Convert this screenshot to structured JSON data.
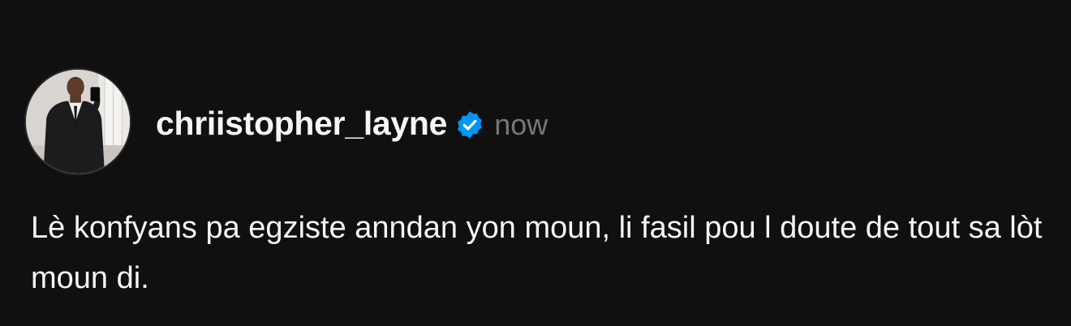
{
  "post": {
    "username": "chriistopher_layne",
    "timestamp": "now",
    "text": "Lè konfyans pa egziste anndan yon moun, li fasil pou l doute de tout sa lòt moun di.",
    "avatar_icon": "profile-photo",
    "verified_icon": "verified-badge-icon"
  },
  "colors": {
    "background": "#101010",
    "text_primary": "#f3f5f7",
    "text_secondary": "#777777",
    "verified_blue": "#0095f6"
  }
}
